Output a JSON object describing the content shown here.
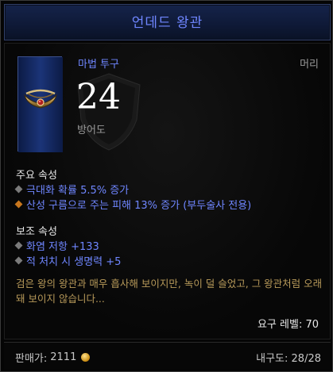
{
  "item": {
    "name": "언데드 왕관",
    "type": "마법 투구",
    "slot": "머리",
    "armor_value": "24",
    "armor_label": "방어도"
  },
  "primary": {
    "title": "주요 속성",
    "affixes": [
      {
        "text": "극대화 확률 5.5% 증가",
        "bullet": "gray"
      },
      {
        "text": "산성 구름으로 주는 피해 13% 증가 (부두술사 전용)",
        "bullet": "orange"
      }
    ]
  },
  "secondary": {
    "title": "보조 속성",
    "affixes": [
      {
        "text": "화염 저항 +133",
        "bullet": "gray"
      },
      {
        "text": "적 처치 시 생명력 +5",
        "bullet": "gray"
      }
    ]
  },
  "flavor_text": "검은 왕의 왕관과 매우 흡사해 보이지만, 녹이 덜 슬었고, 그 왕관처럼 오래돼 보이지 않습니다...",
  "requirement": "요구 레벨: 70",
  "footer": {
    "sell_label": "판매가:",
    "sell_value": "2111",
    "durability": "내구도: 28/28"
  },
  "colors": {
    "magic_blue": "#6f86ff",
    "flavor": "#b89a5a",
    "set_orange": "#c7761d"
  },
  "icons": {
    "item": "crown-icon",
    "currency": "gold-coin-icon"
  }
}
